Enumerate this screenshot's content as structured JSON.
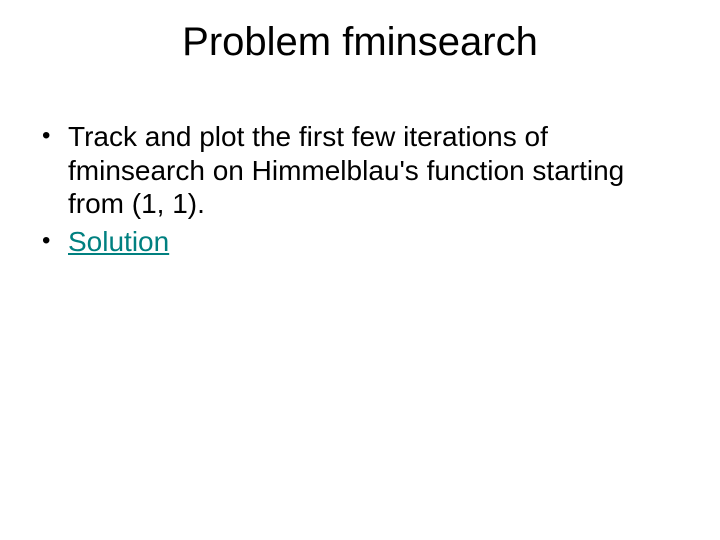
{
  "title": "Problem fminsearch",
  "bullets": [
    {
      "text": "Track and plot the first few iterations of fminsearch on Himmelblau's function starting from (1, 1).",
      "type": "text"
    },
    {
      "text": "Solution",
      "type": "link"
    }
  ]
}
